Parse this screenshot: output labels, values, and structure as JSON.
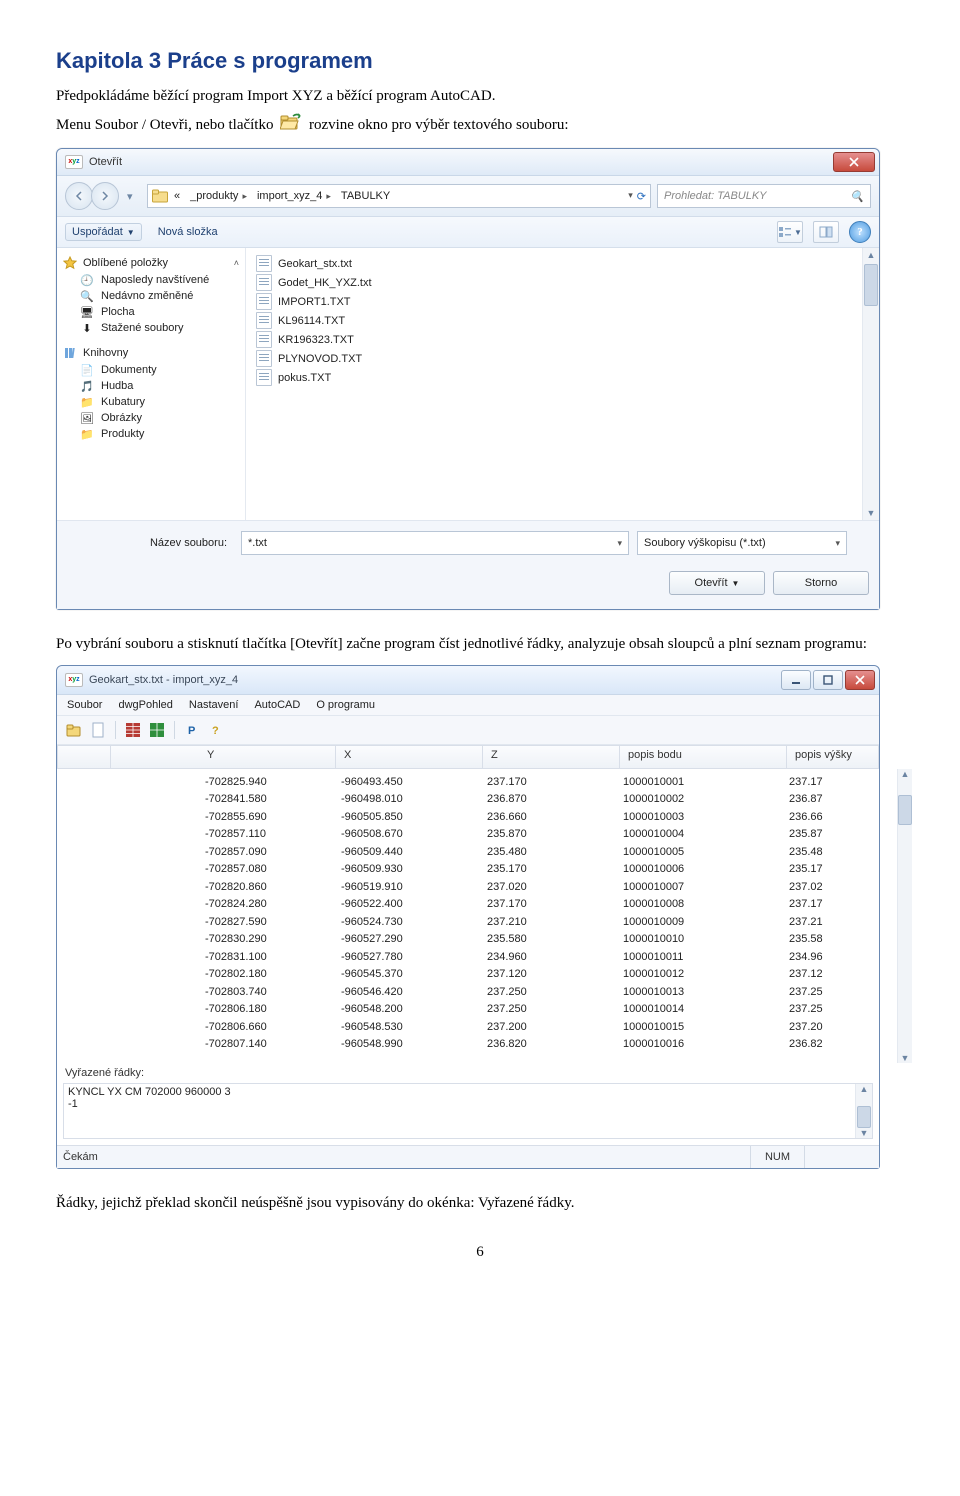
{
  "doc": {
    "chapter_heading": "Kapitola 3  Práce s programem",
    "intro": "Předpokládáme běžící program Import XYZ a běžící program AutoCAD.",
    "line2_a": "Menu Soubor / Otevři, nebo tlačítko ",
    "line2_b": " rozvine okno pro výběr textového souboru:",
    "between": "Po vybrání souboru a stisknutí tlačítka [Otevřít] začne program číst jednotlivé řádky, analyzuje obsah sloupců a plní seznam programu:",
    "after": "Řádky, jejichž překlad skončil neúspěšně jsou vypisovány do okénka: Vyřazené řádky.",
    "page": "6"
  },
  "dlg": {
    "title": "Otevřít",
    "crumb_prefix": "«",
    "crumbs": [
      "_produkty",
      "import_xyz_4",
      "TABULKY"
    ],
    "search_placeholder": "Prohledat: TABULKY",
    "toolbar": {
      "organize": "Uspořádat",
      "newfolder": "Nová složka"
    },
    "side_fav_head": "Oblíbené položky",
    "side_fav": [
      "Naposledy navštívené",
      "Nedávno změněné",
      "Plocha",
      "Stažené soubory"
    ],
    "side_lib_head": "Knihovny",
    "side_lib": [
      "Dokumenty",
      "Hudba",
      "Kubatury",
      "Obrázky",
      "Produkty"
    ],
    "files": [
      "Geokart_stx.txt",
      "Godet_HK_YXZ.txt",
      "IMPORT1.TXT",
      "KL96114.TXT",
      "KR196323.TXT",
      "PLYNOVOD.TXT",
      "pokus.TXT"
    ],
    "footer": {
      "name_label": "Název souboru:",
      "name_value": "*.txt",
      "filter_value": "Soubory výškopisu (*.txt)",
      "open": "Otevřít",
      "cancel": "Storno"
    }
  },
  "app": {
    "title": "Geokart_stx.txt - import_xyz_4",
    "menu": [
      "Soubor",
      "dwgPohled",
      "Nastavení",
      "AutoCAD",
      "O programu"
    ],
    "columns": [
      "Y",
      "X",
      "Z",
      "popis bodu",
      "popis výšky"
    ],
    "rows": [
      {
        "y": "-702825.940",
        "x": "-960493.450",
        "z": "237.170",
        "p1": "1000010001",
        "p2": "237.17"
      },
      {
        "y": "-702841.580",
        "x": "-960498.010",
        "z": "236.870",
        "p1": "1000010002",
        "p2": "236.87"
      },
      {
        "y": "-702855.690",
        "x": "-960505.850",
        "z": "236.660",
        "p1": "1000010003",
        "p2": "236.66"
      },
      {
        "y": "-702857.110",
        "x": "-960508.670",
        "z": "235.870",
        "p1": "1000010004",
        "p2": "235.87"
      },
      {
        "y": "-702857.090",
        "x": "-960509.440",
        "z": "235.480",
        "p1": "1000010005",
        "p2": "235.48"
      },
      {
        "y": "-702857.080",
        "x": "-960509.930",
        "z": "235.170",
        "p1": "1000010006",
        "p2": "235.17"
      },
      {
        "y": "-702820.860",
        "x": "-960519.910",
        "z": "237.020",
        "p1": "1000010007",
        "p2": "237.02"
      },
      {
        "y": "-702824.280",
        "x": "-960522.400",
        "z": "237.170",
        "p1": "1000010008",
        "p2": "237.17"
      },
      {
        "y": "-702827.590",
        "x": "-960524.730",
        "z": "237.210",
        "p1": "1000010009",
        "p2": "237.21"
      },
      {
        "y": "-702830.290",
        "x": "-960527.290",
        "z": "235.580",
        "p1": "1000010010",
        "p2": "235.58"
      },
      {
        "y": "-702831.100",
        "x": "-960527.780",
        "z": "234.960",
        "p1": "1000010011",
        "p2": "234.96"
      },
      {
        "y": "-702802.180",
        "x": "-960545.370",
        "z": "237.120",
        "p1": "1000010012",
        "p2": "237.12"
      },
      {
        "y": "-702803.740",
        "x": "-960546.420",
        "z": "237.250",
        "p1": "1000010013",
        "p2": "237.25"
      },
      {
        "y": "-702806.180",
        "x": "-960548.200",
        "z": "237.250",
        "p1": "1000010014",
        "p2": "237.25"
      },
      {
        "y": "-702806.660",
        "x": "-960548.530",
        "z": "237.200",
        "p1": "1000010015",
        "p2": "237.20"
      },
      {
        "y": "-702807.140",
        "x": "-960548.990",
        "z": "236.820",
        "p1": "1000010016",
        "p2": "236.82"
      }
    ],
    "rejected_label": "Vyřazené řádky:",
    "rejected_text1": "KYNCL YX CM 702000 960000 3",
    "rejected_text2": "-1",
    "status_left": "Čekám",
    "status_num": "NUM"
  },
  "icons": {
    "open_toolbar": "open-folder-icon"
  }
}
